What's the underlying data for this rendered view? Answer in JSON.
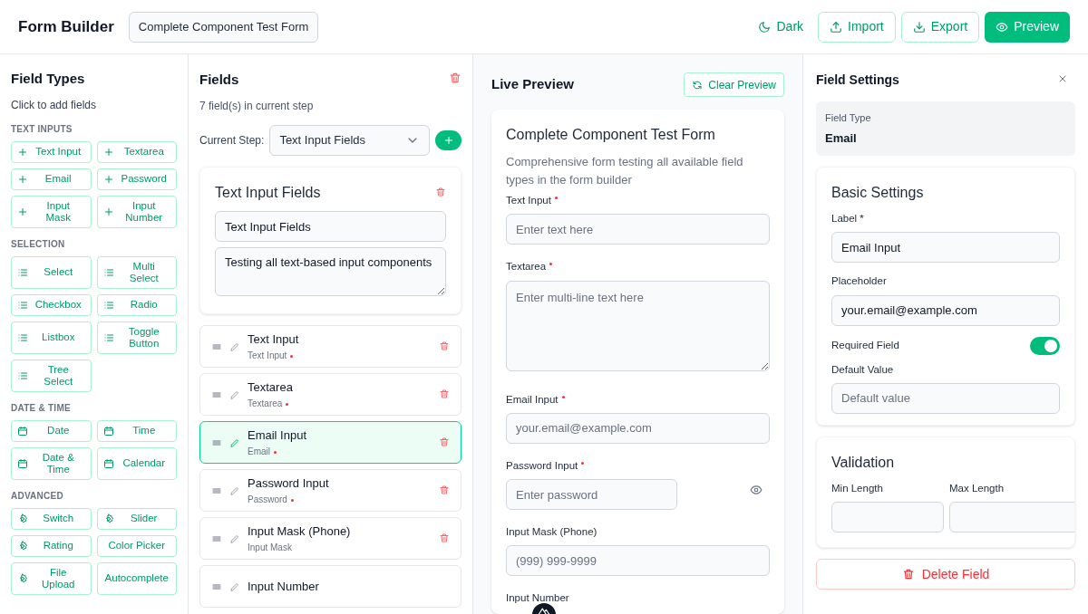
{
  "header": {
    "title": "Form Builder",
    "form_name": "Complete Component Test Form",
    "buttons": [
      "Dark",
      "Import",
      "Export",
      "Preview"
    ]
  },
  "field_types": {
    "title": "Field Types",
    "subtitle": "Click to add fields",
    "sections": [
      {
        "heading": "TEXT INPUTS",
        "kind": "plus",
        "items": [
          "Text Input",
          "Textarea",
          "Email",
          "Password",
          "Input Mask",
          "Input Number"
        ]
      },
      {
        "heading": "SELECTION",
        "kind": "list",
        "items": [
          "Select",
          "Multi Select",
          "Checkbox",
          "Radio",
          "Listbox",
          "Toggle Button",
          "Tree Select"
        ]
      },
      {
        "heading": "DATE & TIME",
        "kind": "calendar",
        "items": [
          "Date",
          "Time",
          "Date & Time",
          "Calendar"
        ]
      },
      {
        "heading": "ADVANCED",
        "kind": "gear",
        "items": [
          "Switch",
          "Slider",
          "Rating",
          "Color Picker",
          "File Upload",
          "Autocomplete"
        ]
      }
    ]
  },
  "fields": {
    "title": "Fields",
    "count": "7 field(s) in current step",
    "step_label": "Current Step:",
    "step_value": "Text Input Fields",
    "step_card": {
      "title": "Text Input Fields",
      "name_value": "Text Input Fields",
      "description_value": "Testing all text-based input components"
    },
    "items": [
      {
        "label": "Text Input",
        "type": "Text Input",
        "required": true,
        "selected": false
      },
      {
        "label": "Textarea",
        "type": "Textarea",
        "required": true,
        "selected": false
      },
      {
        "label": "Email Input",
        "type": "Email",
        "required": true,
        "selected": true
      },
      {
        "label": "Password Input",
        "type": "Password",
        "required": true,
        "selected": false
      },
      {
        "label": "Input Mask (Phone)",
        "type": "Input Mask",
        "required": false,
        "selected": false
      },
      {
        "label": "Input Number",
        "selected": false
      }
    ]
  },
  "preview": {
    "title": "Live Preview",
    "clear_button": "Clear Preview",
    "form_title": "Complete Component Test Form",
    "form_description": "Comprehensive form testing all available field types in the form builder",
    "fields": [
      {
        "label": "Text Input",
        "required": true,
        "kind": "input",
        "placeholder": "Enter text here"
      },
      {
        "label": "Textarea",
        "required": true,
        "kind": "textarea",
        "placeholder": "Enter multi-line text here"
      },
      {
        "label": "Email Input",
        "required": true,
        "kind": "input",
        "placeholder": "your.email@example.com"
      },
      {
        "label": "Password Input",
        "required": true,
        "kind": "password",
        "placeholder": "Enter password"
      },
      {
        "label": "Input Mask (Phone)",
        "required": false,
        "kind": "input",
        "placeholder": "(999) 999-9999"
      },
      {
        "label": "Input Number",
        "required": false,
        "kind": "label"
      }
    ]
  },
  "settings": {
    "title": "Field Settings",
    "type_label": "Field Type",
    "type_value": "Email",
    "basic": {
      "heading": "Basic Settings",
      "label_label": "Label *",
      "label_value": "Email Input",
      "placeholder_label": "Placeholder",
      "placeholder_field": {
        "value": "your.email@example.com"
      },
      "required_label": "Required Field",
      "required_on": true,
      "default_label": "Default Value",
      "default_placeholder": "Default value"
    },
    "validation": {
      "heading": "Validation",
      "min_label": "Min Length",
      "max_label": "Max Length"
    },
    "delete_button": "Delete Field"
  }
}
